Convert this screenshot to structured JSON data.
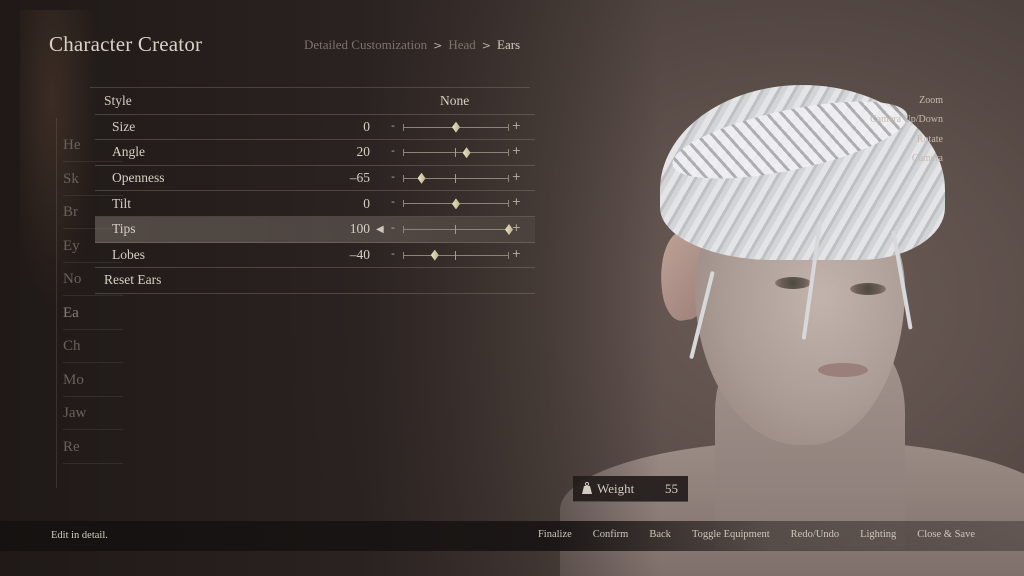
{
  "header": {
    "title": "Character Creator",
    "breadcrumb": [
      "Detailed Customization",
      "Head",
      "Ears"
    ],
    "breadcrumb_separator": ">"
  },
  "categories": [
    {
      "label": "He",
      "active": false
    },
    {
      "label": "Sk",
      "active": false
    },
    {
      "label": "Br",
      "active": false
    },
    {
      "label": "Ey",
      "active": false
    },
    {
      "label": "No",
      "active": false
    },
    {
      "label": "Ea",
      "active": true
    },
    {
      "label": "Ch",
      "active": false
    },
    {
      "label": "Mo",
      "active": false
    },
    {
      "label": "Jaw",
      "active": false
    },
    {
      "label": "Re",
      "active": false
    }
  ],
  "options": {
    "style": {
      "label": "Style",
      "value": "None"
    },
    "sliders": [
      {
        "label": "Size",
        "value": 0,
        "selected": false
      },
      {
        "label": "Angle",
        "value": 20,
        "selected": false
      },
      {
        "label": "Openness",
        "value": -65,
        "selected": false
      },
      {
        "label": "Tilt",
        "value": 0,
        "selected": false
      },
      {
        "label": "Tips",
        "value": 100,
        "selected": true
      },
      {
        "label": "Lobes",
        "value": -40,
        "selected": false
      }
    ],
    "slider_range": [
      -100,
      100
    ],
    "slider_minus": "-",
    "slider_plus": "+",
    "selected_arrow": "◀",
    "reset_label": "Reset Ears"
  },
  "camera_hints": [
    "Zoom",
    "Camera Up/Down",
    "Rotate",
    "Camera"
  ],
  "weight": {
    "icon": "weight-icon",
    "label": "Weight",
    "value": "55"
  },
  "footer": {
    "status": "Edit in detail.",
    "actions": [
      "Finalize",
      "Confirm",
      "Back",
      "Toggle Equipment",
      "Redo/Undo",
      "Lighting",
      "Close & Save"
    ]
  },
  "colors": {
    "thumb": "#e9e3c4",
    "text": "#d6cfc3",
    "muted": "#7c736b"
  }
}
